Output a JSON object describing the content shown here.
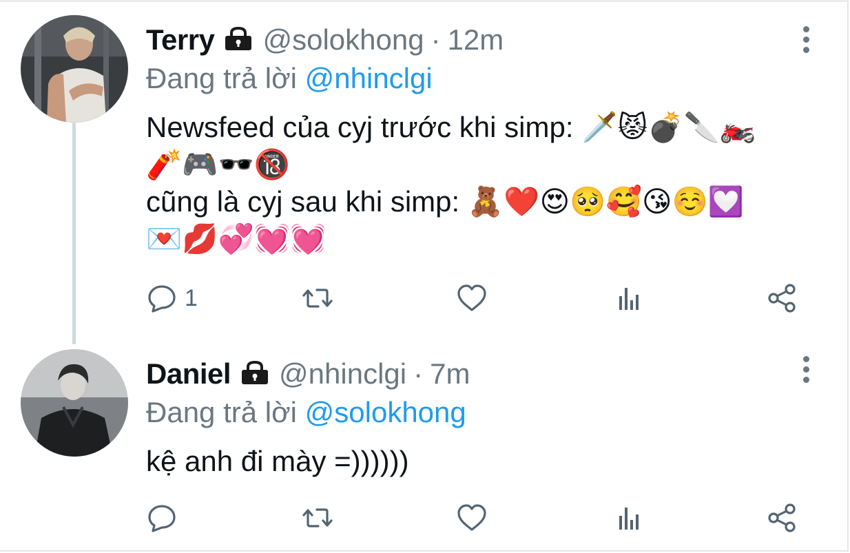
{
  "tweets": [
    {
      "display_name": "Terry",
      "handle": "@solokhong",
      "separator": "·",
      "time": "12m",
      "reply_prefix": "Đang trả lời ",
      "reply_to": "@nhinclgi",
      "lines": [
        "Newsfeed của cyj trước khi simp: 🗡️😾💣🔪🏍️",
        "🧨🎮🕶️🔞",
        "cũng là cyj sau khi simp: 🧸❤️😍🥺🥰😘☺️💟",
        "💌💋💞💓💓"
      ],
      "reply_count": "1",
      "avatar_icon": "person-photo-avatar-icon"
    },
    {
      "display_name": "Daniel",
      "handle": "@nhinclgi",
      "separator": "·",
      "time": "7m",
      "reply_prefix": "Đang trả lời ",
      "reply_to": "@solokhong",
      "lines": [
        "kệ anh đi mày =))))))"
      ],
      "reply_count": "",
      "avatar_icon": "person-photo-avatar-icon"
    }
  ],
  "icons": {
    "lock": "lock-icon",
    "more": "more-vertical-icon",
    "reply": "reply-bubble-icon",
    "retweet": "retweet-icon",
    "like": "heart-icon",
    "views": "analytics-bars-icon",
    "share": "share-icon"
  },
  "colors": {
    "mention": "#1d9bf0",
    "secondary_text": "#6b7780",
    "thread_line": "#cfd9de"
  }
}
